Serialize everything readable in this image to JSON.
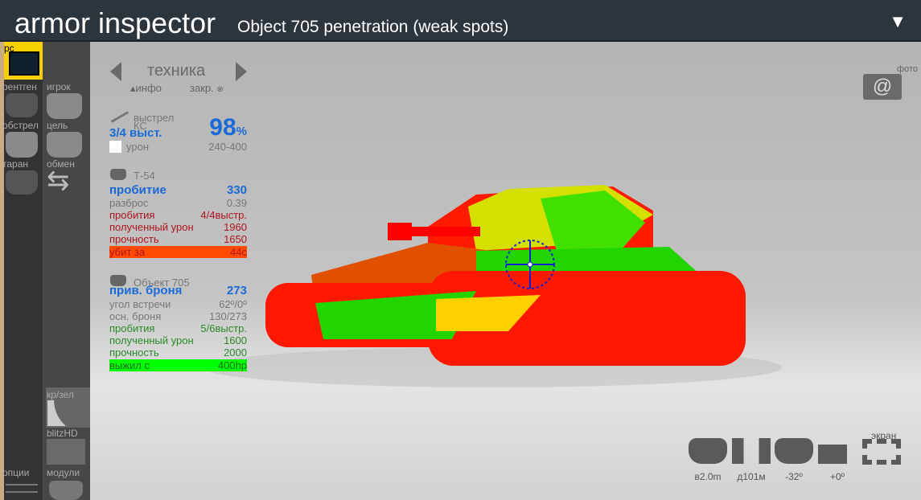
{
  "header": {
    "title": "armor inspector",
    "subtitle": "Object 705 penetration (weak spots)",
    "menu_icon": "triangle-down-icon"
  },
  "sidebar": {
    "col1": [
      {
        "label": "рс",
        "active": true,
        "color": "#f7d000"
      },
      {
        "label": "рентген"
      },
      {
        "label": "обстрел"
      },
      {
        "label": "таран"
      },
      {
        "label": "опции"
      }
    ],
    "col2": [
      {
        "label": "игрок"
      },
      {
        "label": "цель"
      },
      {
        "label": "обмен"
      },
      {
        "label": "кр/зел"
      },
      {
        "label": "blitzHD"
      },
      {
        "label": "модули"
      }
    ]
  },
  "vehicle_nav": {
    "label": "техника",
    "info": "инфо",
    "lock": "закр."
  },
  "photo": {
    "label": "фото"
  },
  "shot": {
    "title": "выстрел",
    "ammo": "КС",
    "shots": "3/4 выст.",
    "percent": "98",
    "percent_unit": "%",
    "damage_label": "урон",
    "damage": "240-400"
  },
  "attacker": {
    "name": "Т-54",
    "pen_label": "пробитие",
    "pen": "330",
    "spread_label": "разброс",
    "spread": "0.39",
    "hits_label": "пробития",
    "hits": "4/4выстр.",
    "dmg_label": "полученный урон",
    "dmg": "1960",
    "hp_label": "прочность",
    "hp": "1650",
    "result_label": "убит за",
    "result": "44с",
    "result_color": "#ff4a00"
  },
  "target": {
    "name": "Объект 705",
    "armor_label": "прив. броня",
    "armor": "273",
    "angle_label": "угол встречи",
    "angle": "62º/0º",
    "base_label": "осн. броня",
    "base": "130/273",
    "hits_label": "пробития",
    "hits": "5/6выстр.",
    "dmg_label": "полученный урон",
    "dmg": "1600",
    "hp_label": "прочность",
    "hp": "2000",
    "result_label": "выжил с",
    "result": "400hp",
    "result_color": "#00ff00"
  },
  "controls": {
    "screen": "экран",
    "height": "в2.0m",
    "distance": "д101м",
    "angle": "-32º",
    "turret": "+0º"
  },
  "colors": {
    "penetrable": "#00e000",
    "unsure": "#e8e800",
    "bounce": "#ff0000"
  }
}
